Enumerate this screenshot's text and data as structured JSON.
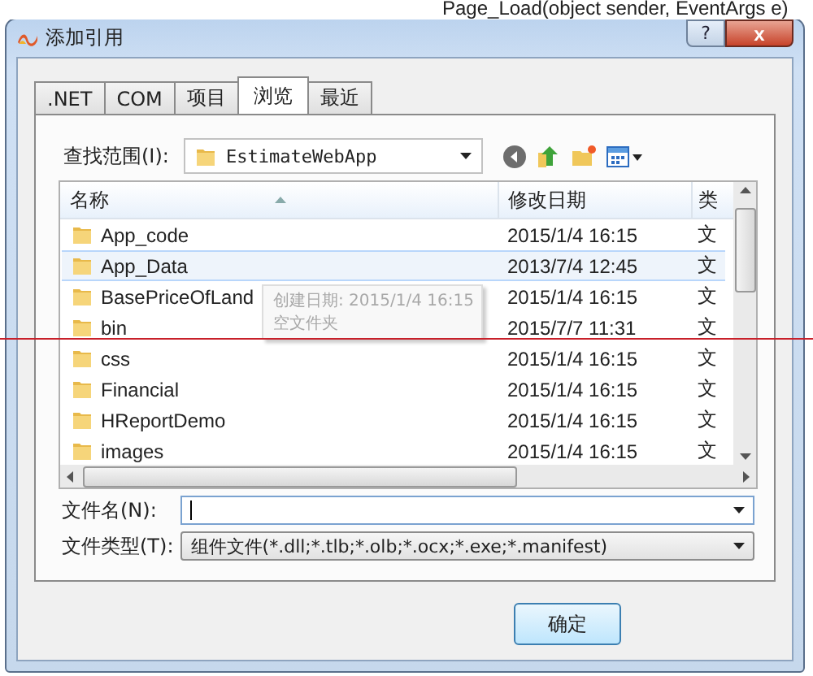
{
  "background": {
    "method": "Page_Load(object sender, EventArgs e)"
  },
  "window": {
    "title": "添加引用",
    "help": "?",
    "close": "x"
  },
  "tabs": [
    {
      "label": ".NET",
      "selected": false
    },
    {
      "label": "COM",
      "selected": false
    },
    {
      "label": "项目",
      "selected": false
    },
    {
      "label": "浏览",
      "selected": true
    },
    {
      "label": "最近",
      "selected": false
    }
  ],
  "look_in": {
    "label": "查找范围(I):",
    "value": "EstimateWebApp"
  },
  "file_list": {
    "columns": [
      "名称",
      "修改日期",
      "类"
    ],
    "rows": [
      {
        "name": "App_code",
        "modified": "2015/1/4 16:15",
        "type": "文",
        "selected": false
      },
      {
        "name": "App_Data",
        "modified": "2013/7/4 12:45",
        "type": "文",
        "selected": true
      },
      {
        "name": "BasePriceOfLand",
        "modified": "2015/1/4 16:15",
        "type": "文",
        "selected": false
      },
      {
        "name": "bin",
        "modified": "2015/7/7 11:31",
        "type": "文",
        "selected": false
      },
      {
        "name": "css",
        "modified": "2015/1/4 16:15",
        "type": "文",
        "selected": false
      },
      {
        "name": "Financial",
        "modified": "2015/1/4 16:15",
        "type": "文",
        "selected": false
      },
      {
        "name": "HReportDemo",
        "modified": "2015/1/4 16:15",
        "type": "文",
        "selected": false
      },
      {
        "name": "images",
        "modified": "2015/1/4 16:15",
        "type": "文",
        "selected": false
      }
    ]
  },
  "tooltip": {
    "lines": [
      "创建日期: 2015/1/4 16:15",
      "空文件夹"
    ]
  },
  "file_name": {
    "label": "文件名(N):"
  },
  "file_type": {
    "label": "文件类型(T):",
    "value": "组件文件(*.dll;*.tlb;*.olb;*.ocx;*.exe;*.manifest)"
  },
  "buttons": [
    "确定"
  ]
}
